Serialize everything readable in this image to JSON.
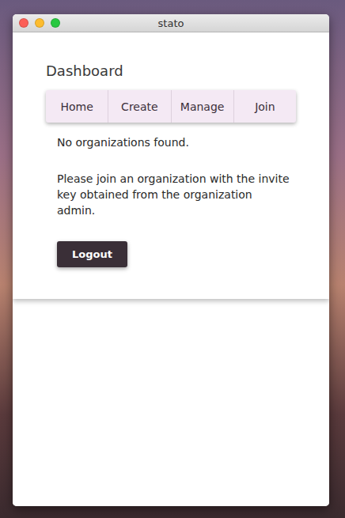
{
  "window": {
    "title": "stato"
  },
  "page": {
    "title": "Dashboard"
  },
  "tabs": [
    {
      "label": "Home",
      "selected": false
    },
    {
      "label": "Create",
      "selected": false
    },
    {
      "label": "Manage",
      "selected": false
    },
    {
      "label": "Join",
      "selected": false
    }
  ],
  "message": "No organizations found.",
  "hint": "Please join an organization with the invite key obtained from the organization admin.",
  "buttons": [
    "Logout"
  ]
}
